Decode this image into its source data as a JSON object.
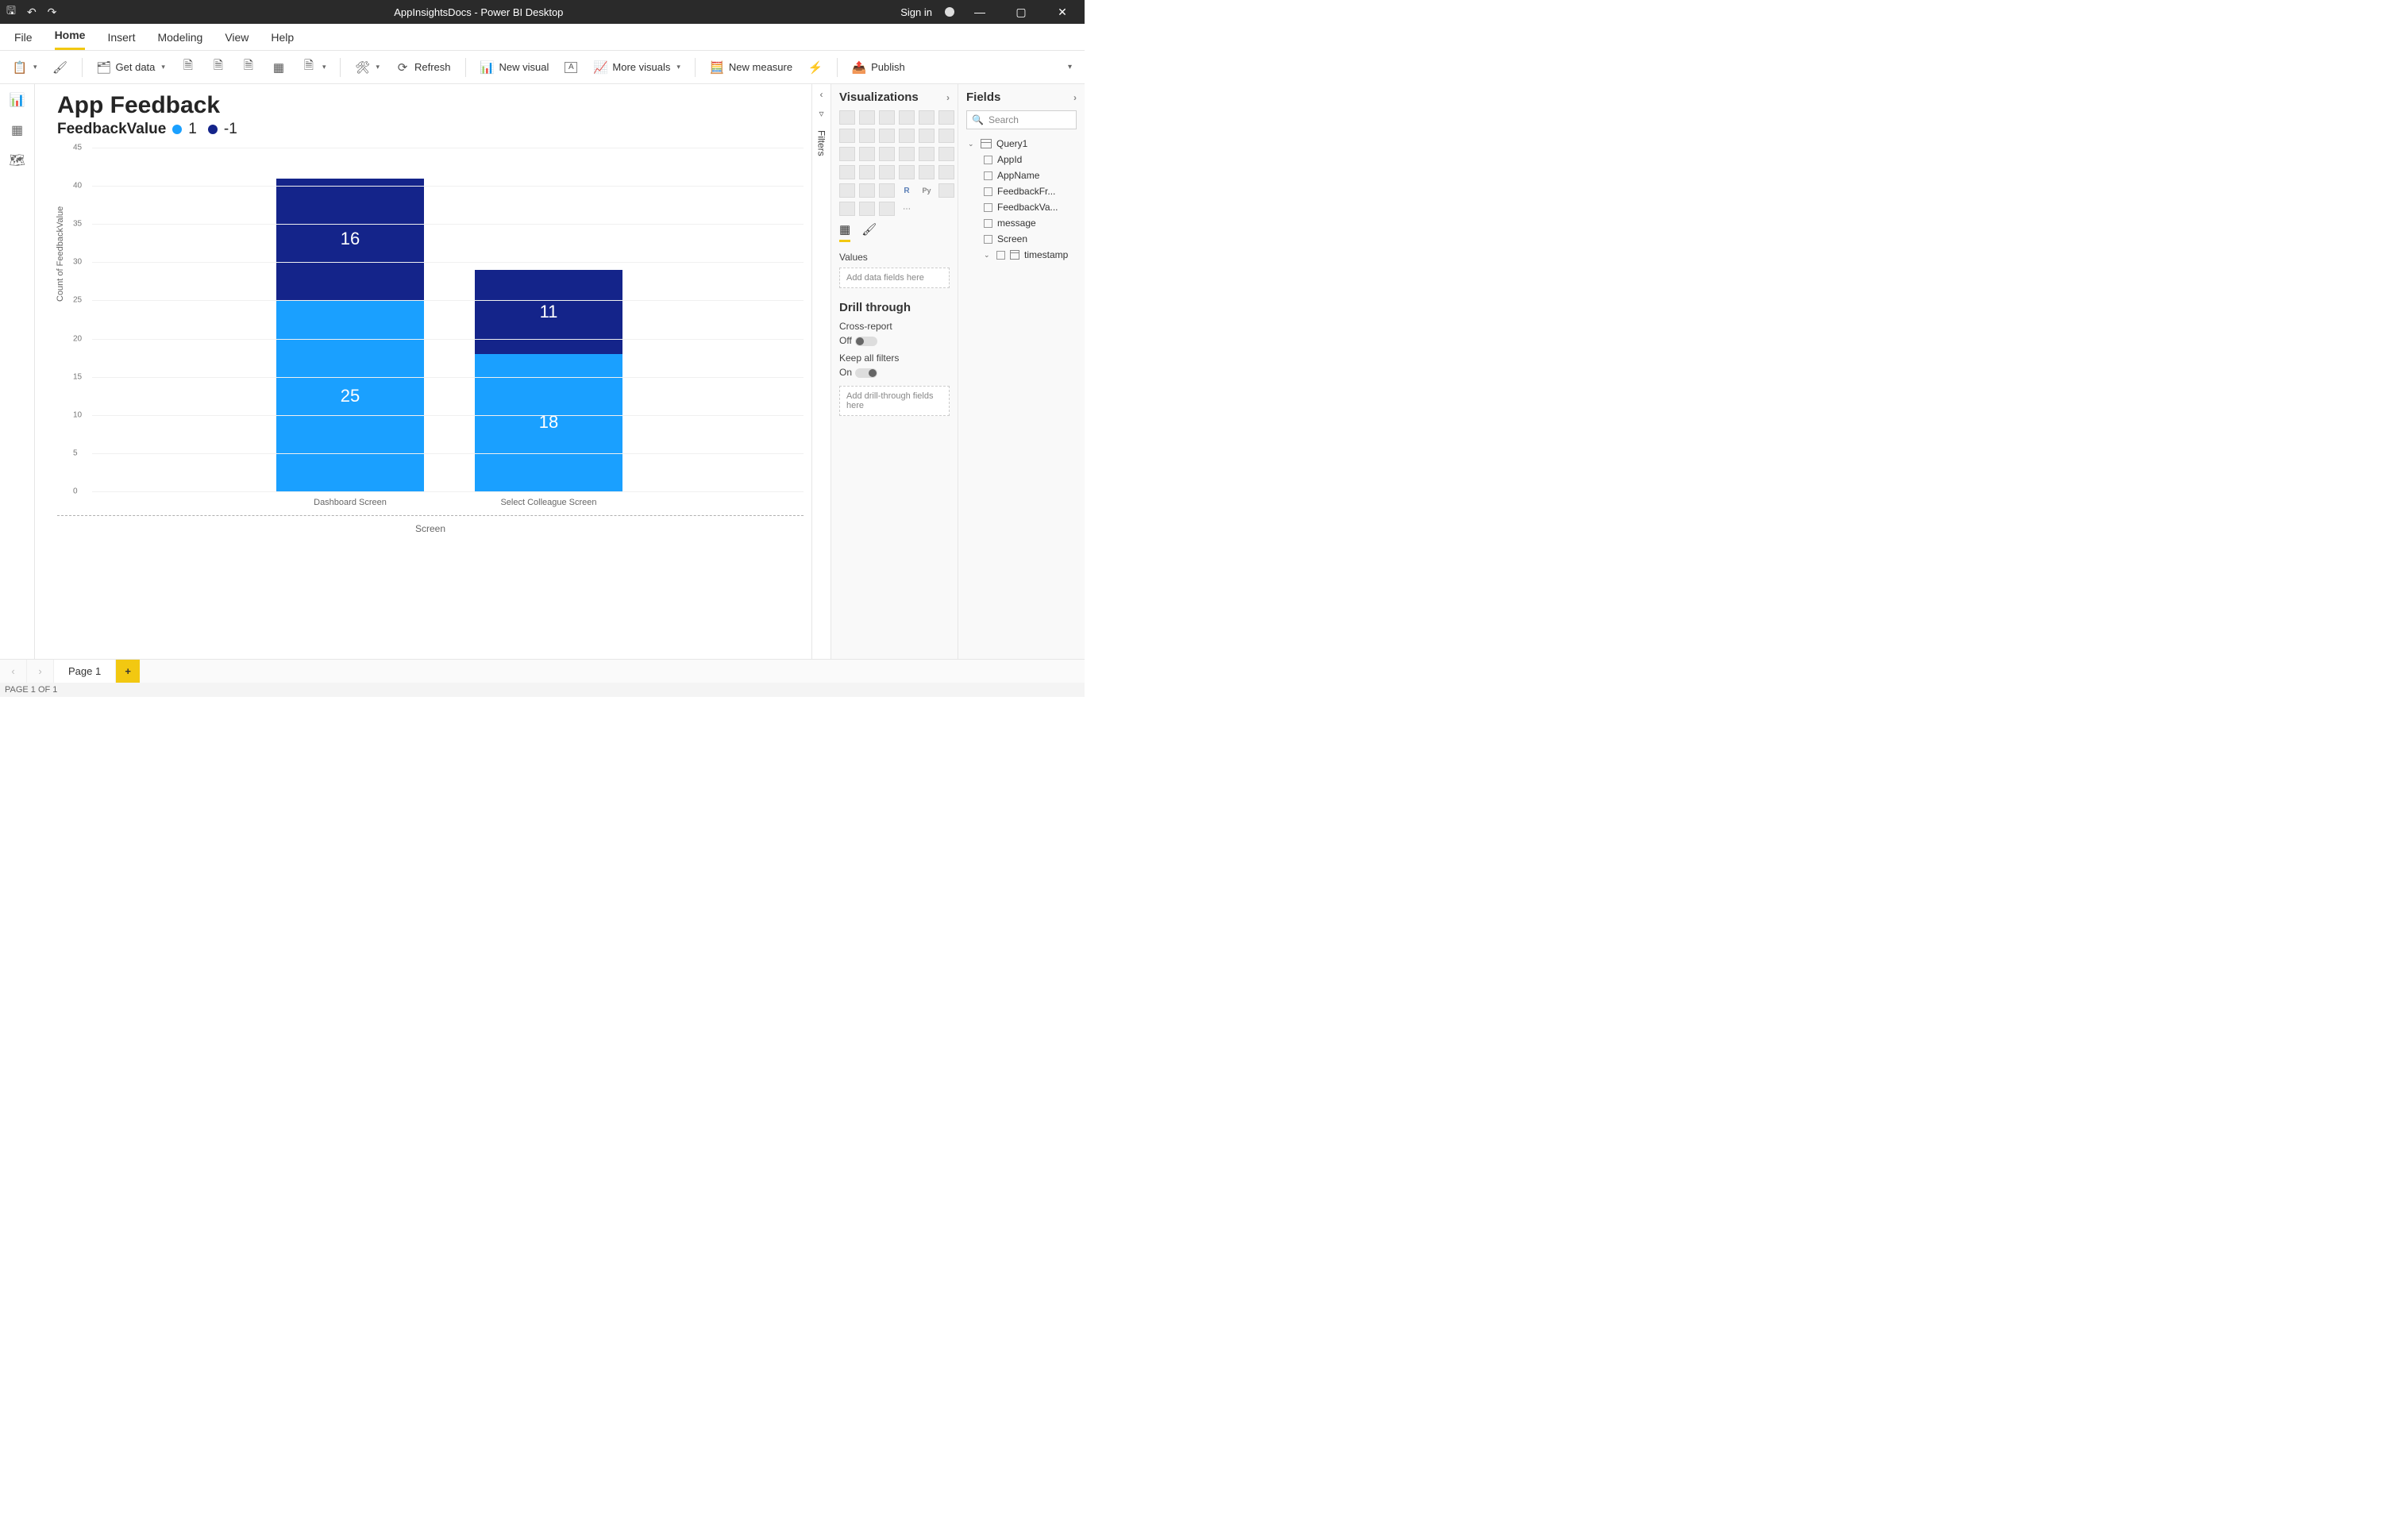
{
  "app": {
    "title": "AppInsightsDocs - Power BI Desktop",
    "signin": "Sign in"
  },
  "menu": {
    "items": [
      "File",
      "Home",
      "Insert",
      "Modeling",
      "View",
      "Help"
    ],
    "active": "Home"
  },
  "ribbon": {
    "getdata": "Get data",
    "refresh": "Refresh",
    "newvisual": "New visual",
    "morevisuals": "More visuals",
    "newmeasure": "New measure",
    "publish": "Publish"
  },
  "filters": {
    "label": "Filters"
  },
  "viz": {
    "header": "Visualizations",
    "values_label": "Values",
    "values_placeholder": "Add data fields here",
    "drill_header": "Drill through",
    "cross_label": "Cross-report",
    "cross_state": "Off",
    "keep_label": "Keep all filters",
    "keep_state": "On",
    "drill_placeholder": "Add drill-through fields here"
  },
  "fields": {
    "header": "Fields",
    "search_placeholder": "Search",
    "table": "Query1",
    "cols": [
      "AppId",
      "AppName",
      "FeedbackFr...",
      "FeedbackVa...",
      "message",
      "Screen",
      "timestamp"
    ]
  },
  "pages": {
    "tab": "Page 1",
    "status": "PAGE 1 OF 1"
  },
  "report": {
    "title": "App Feedback",
    "legend_field": "FeedbackValue",
    "legend_series": [
      {
        "label": "1",
        "color": "#1aa0ff"
      },
      {
        "label": "-1",
        "color": "#14248a"
      }
    ],
    "yaxis": "Count of FeedbackValue",
    "xaxis": "Screen"
  },
  "chart_data": {
    "type": "bar",
    "stacked": true,
    "xlabel": "Screen",
    "ylabel": "Count of FeedbackValue",
    "ylim": [
      0,
      45
    ],
    "yticks": [
      0,
      5,
      10,
      15,
      20,
      25,
      30,
      35,
      40,
      45
    ],
    "categories": [
      "Dashboard Screen",
      "Select Colleague Screen"
    ],
    "series": [
      {
        "name": "1",
        "color": "#1aa0ff",
        "values": [
          25,
          18
        ]
      },
      {
        "name": "-1",
        "color": "#14248a",
        "values": [
          16,
          11
        ]
      }
    ]
  }
}
